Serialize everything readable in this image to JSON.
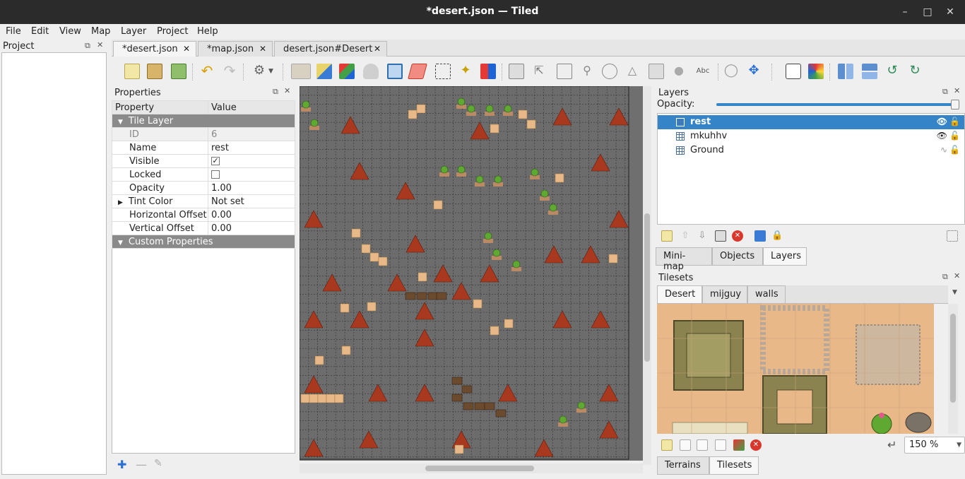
{
  "window": {
    "title": "*desert.json — Tiled"
  },
  "menu": [
    "File",
    "Edit",
    "View",
    "Map",
    "Layer",
    "Project",
    "Help"
  ],
  "project_panel": {
    "title": "Project"
  },
  "document_tabs": [
    {
      "label": "*desert.json",
      "active": true
    },
    {
      "label": "*map.json",
      "active": false
    },
    {
      "label": "desert.json#Desert",
      "active": false
    }
  ],
  "properties": {
    "title": "Properties",
    "col_property": "Property",
    "col_value": "Value",
    "group_tile_layer": "Tile Layer",
    "rows": [
      {
        "key": "ID",
        "value": "6"
      },
      {
        "key": "Name",
        "value": "rest"
      },
      {
        "key": "Visible",
        "value": "✓"
      },
      {
        "key": "Locked",
        "value": ""
      },
      {
        "key": "Opacity",
        "value": "1.00"
      },
      {
        "key": "Tint Color",
        "value": "Not set"
      },
      {
        "key": "Horizontal Offset",
        "value": "0.00"
      },
      {
        "key": "Vertical Offset",
        "value": "0.00"
      }
    ],
    "group_custom": "Custom Properties"
  },
  "layers_panel": {
    "title": "Layers",
    "opacity_label": "Opacity:",
    "opacity_value": 1.0,
    "layers": [
      {
        "name": "rest",
        "selected": true,
        "visible": true
      },
      {
        "name": "mkuhhv",
        "selected": false,
        "visible": true
      },
      {
        "name": "Ground",
        "selected": false,
        "visible": false
      }
    ],
    "tabs": [
      "Mini-map",
      "Objects",
      "Layers"
    ]
  },
  "tilesets_panel": {
    "title": "Tilesets",
    "tabs": [
      "Desert",
      "mijguy",
      "walls"
    ],
    "zoom": "150 %",
    "bottom_tabs": [
      "Terrains",
      "Tilesets"
    ]
  },
  "colors": {
    "accent": "#3584c8",
    "sand": "#e9b889",
    "map_bg": "#6f6f6f",
    "cone": "#a8391f"
  }
}
